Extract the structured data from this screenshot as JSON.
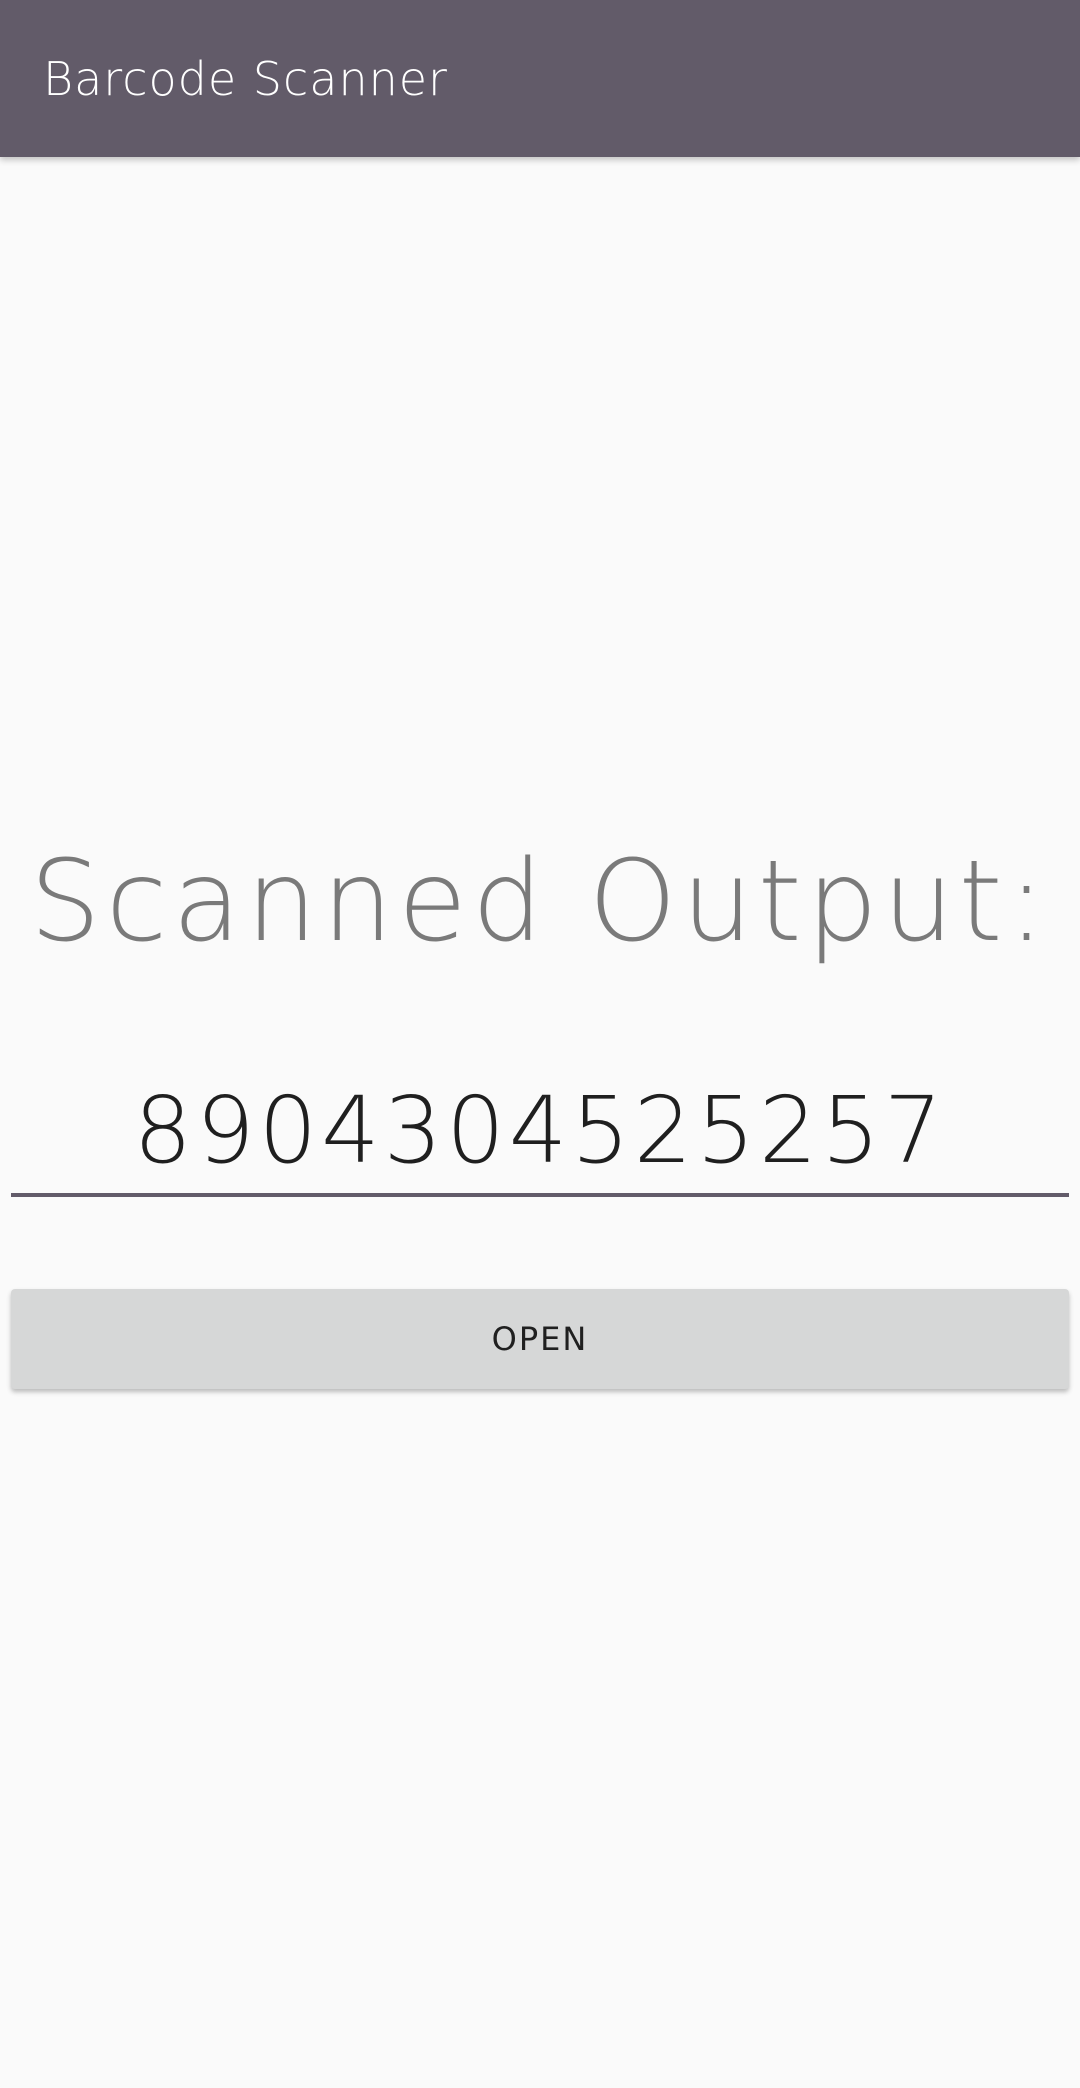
{
  "app_bar": {
    "title": "Barcode Scanner",
    "background_color": "#625b69",
    "title_color": "#ffffff"
  },
  "main": {
    "heading": "Scanned Output:",
    "scanned_value": "8904304525257",
    "open_button_label": "OPEN"
  },
  "colors": {
    "background": "#fafafa",
    "heading_text": "#7a7a7a",
    "value_text": "#1f1f1f",
    "field_underline": "#625b69",
    "button_background": "#d6d7d7"
  }
}
